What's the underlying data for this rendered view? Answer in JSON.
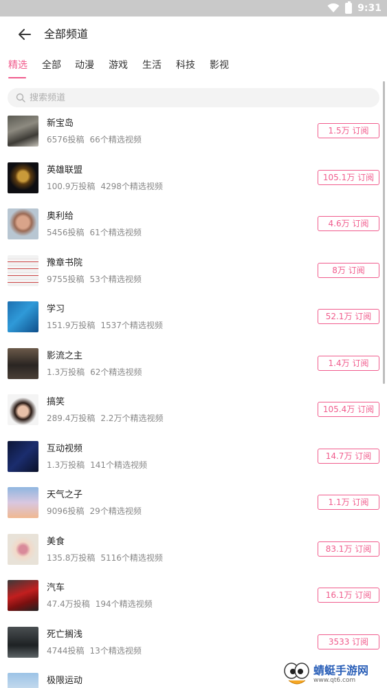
{
  "status_bar": {
    "time": "9:31"
  },
  "header": {
    "title": "全部频道"
  },
  "tabs": [
    {
      "label": "精选",
      "active": true
    },
    {
      "label": "全部"
    },
    {
      "label": "动漫"
    },
    {
      "label": "游戏"
    },
    {
      "label": "生活"
    },
    {
      "label": "科技"
    },
    {
      "label": "影视"
    }
  ],
  "search": {
    "placeholder": "搜索频道"
  },
  "colors": {
    "accent": "#f05b8c",
    "status_bar": "#c9c9c9"
  },
  "channels": [
    {
      "name": "新宝岛",
      "posts": "6576投稿",
      "featured": "66个精选视频",
      "subscribe": "1.5万 订阅"
    },
    {
      "name": "英雄联盟",
      "posts": "100.9万投稿",
      "featured": "4298个精选视频",
      "subscribe": "105.1万 订阅"
    },
    {
      "name": "奥利给",
      "posts": "5456投稿",
      "featured": "61个精选视频",
      "subscribe": "4.6万 订阅"
    },
    {
      "name": "豫章书院",
      "posts": "9755投稿",
      "featured": "53个精选视频",
      "subscribe": "8万 订阅"
    },
    {
      "name": "学习",
      "posts": "151.9万投稿",
      "featured": "1537个精选视频",
      "subscribe": "52.1万 订阅"
    },
    {
      "name": "影流之主",
      "posts": "1.3万投稿",
      "featured": "62个精选视频",
      "subscribe": "1.4万 订阅"
    },
    {
      "name": "搞笑",
      "posts": "289.4万投稿",
      "featured": "2.2万个精选视频",
      "subscribe": "105.4万 订阅"
    },
    {
      "name": "互动视频",
      "posts": "1.3万投稿",
      "featured": "141个精选视频",
      "subscribe": "14.7万 订阅"
    },
    {
      "name": "天气之子",
      "posts": "9096投稿",
      "featured": "29个精选视频",
      "subscribe": "1.1万 订阅"
    },
    {
      "name": "美食",
      "posts": "135.8万投稿",
      "featured": "5116个精选视频",
      "subscribe": "83.1万 订阅"
    },
    {
      "name": "汽车",
      "posts": "47.4万投稿",
      "featured": "194个精选视频",
      "subscribe": "16.1万 订阅"
    },
    {
      "name": "死亡搁浅",
      "posts": "4744投稿",
      "featured": "13个精选视频",
      "subscribe": "3533 订阅"
    },
    {
      "name": "极限运动",
      "posts": "",
      "featured": "",
      "subscribe": ""
    }
  ],
  "watermark": {
    "title": "蜻蜓手游网",
    "url": "www.qt6.com"
  }
}
